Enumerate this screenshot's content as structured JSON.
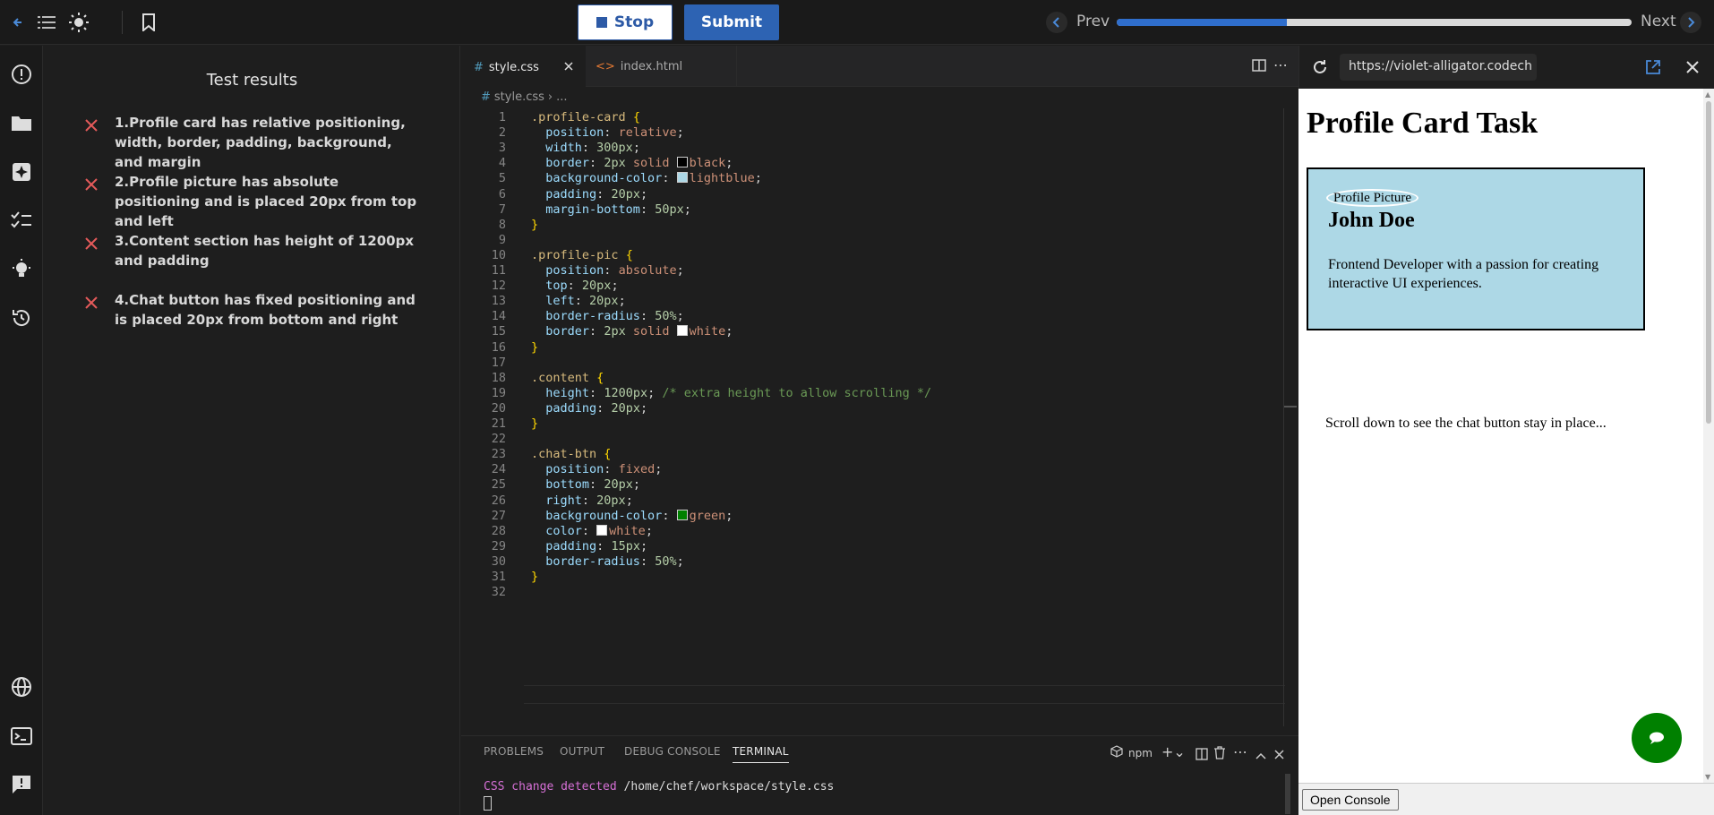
{
  "topbar": {
    "stop_label": "Stop",
    "submit_label": "Submit",
    "prev_label": "Prev",
    "next_label": "Next",
    "progress_fraction": 0.33,
    "accent": "#2d63b3"
  },
  "tests": {
    "title": "Test results",
    "items": [
      {
        "text": "1.Profile card has relative positioning, width, border, padding, background, and margin",
        "status": "fail"
      },
      {
        "text": "2.Profile picture has absolute positioning and is placed 20px from top and left",
        "status": "fail"
      },
      {
        "text": "3.Content section has height of 1200px and padding",
        "status": "fail"
      },
      {
        "text": "4.Chat button has fixed positioning and is placed 20px from bottom and right",
        "status": "fail"
      }
    ]
  },
  "editor": {
    "tabs": [
      {
        "label": "style.css",
        "active": true
      },
      {
        "label": "index.html",
        "active": false
      }
    ],
    "breadcrumb": [
      "style.css",
      "..."
    ],
    "lines": [
      ".profile-card {",
      "  position: relative;",
      "  width: 300px;",
      "  border: 2px solid black;",
      "  background-color: lightblue;",
      "  padding: 20px;",
      "  margin-bottom: 50px;",
      "}",
      "",
      ".profile-pic {",
      "  position: absolute;",
      "  top: 20px;",
      "  left: 20px;",
      "  border-radius: 50%;",
      "  border: 2px solid white;",
      "}",
      "",
      ".content {",
      "  height: 1200px; /* extra height to allow scrolling */",
      "  padding: 20px;",
      "}",
      "",
      ".chat-btn {",
      "  position: fixed;",
      "  bottom: 20px;",
      "  right: 20px;",
      "  background-color: green;",
      "  color: white;",
      "  padding: 15px;",
      "  border-radius: 50%;",
      "}",
      ""
    ]
  },
  "terminal": {
    "tabs": [
      "PROBLEMS",
      "OUTPUT",
      "DEBUG CONSOLE",
      "TERMINAL"
    ],
    "active_tab": "TERMINAL",
    "shell_label": "npm",
    "line_prefix": "CSS change detected",
    "line_path": "/home/chef/workspace/style.css"
  },
  "preview": {
    "url": "https://violet-alligator.codech",
    "page_title": "Profile Card Task",
    "pic_alt": "Profile Picture",
    "name": "John Doe",
    "bio": "Frontend Developer with a passion for creating interactive UI experiences.",
    "scroll_note": "Scroll down to see the chat button stay in place...",
    "console_button": "Open Console"
  }
}
